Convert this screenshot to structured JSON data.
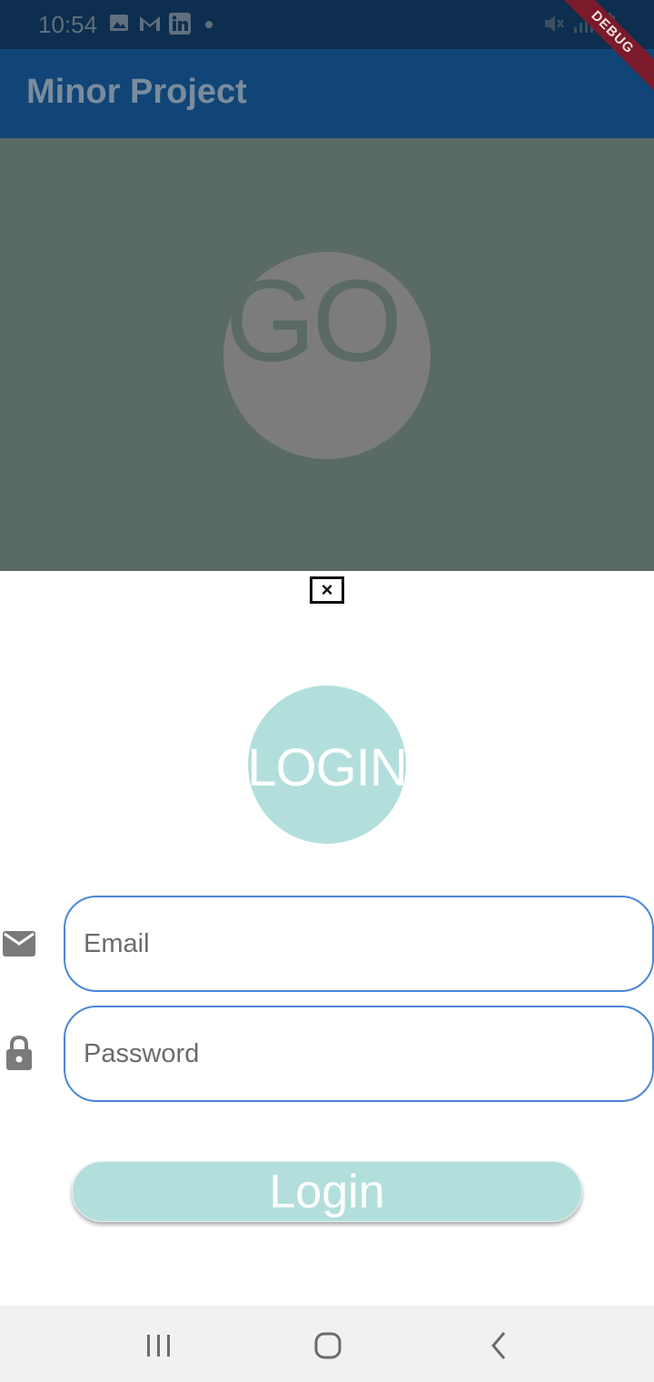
{
  "status_bar": {
    "time": "10:54",
    "icons": [
      "image-icon",
      "gmail-icon",
      "linkedin-icon",
      "notification-dot",
      "mute-icon",
      "signal-icon",
      "battery-icon"
    ]
  },
  "debug_banner": "DEBUG",
  "app_bar": {
    "title": "Minor Project"
  },
  "background": {
    "go_text": "GO"
  },
  "sheet": {
    "close_glyph": "×",
    "login_badge": "LOGIN",
    "email": {
      "placeholder": "Email",
      "value": ""
    },
    "password": {
      "placeholder": "Password",
      "value": ""
    },
    "login_button": "Login"
  },
  "nav_bar": {
    "buttons": [
      "recents-icon",
      "home-icon",
      "back-icon"
    ]
  },
  "colors": {
    "app_bar": "#114577",
    "status_bar": "#0d2e4f",
    "scrim": "#5a6a67",
    "accent_teal": "#b2dfdb",
    "field_border": "#4a86d8",
    "debug_ribbon": "#7b1a2a"
  }
}
